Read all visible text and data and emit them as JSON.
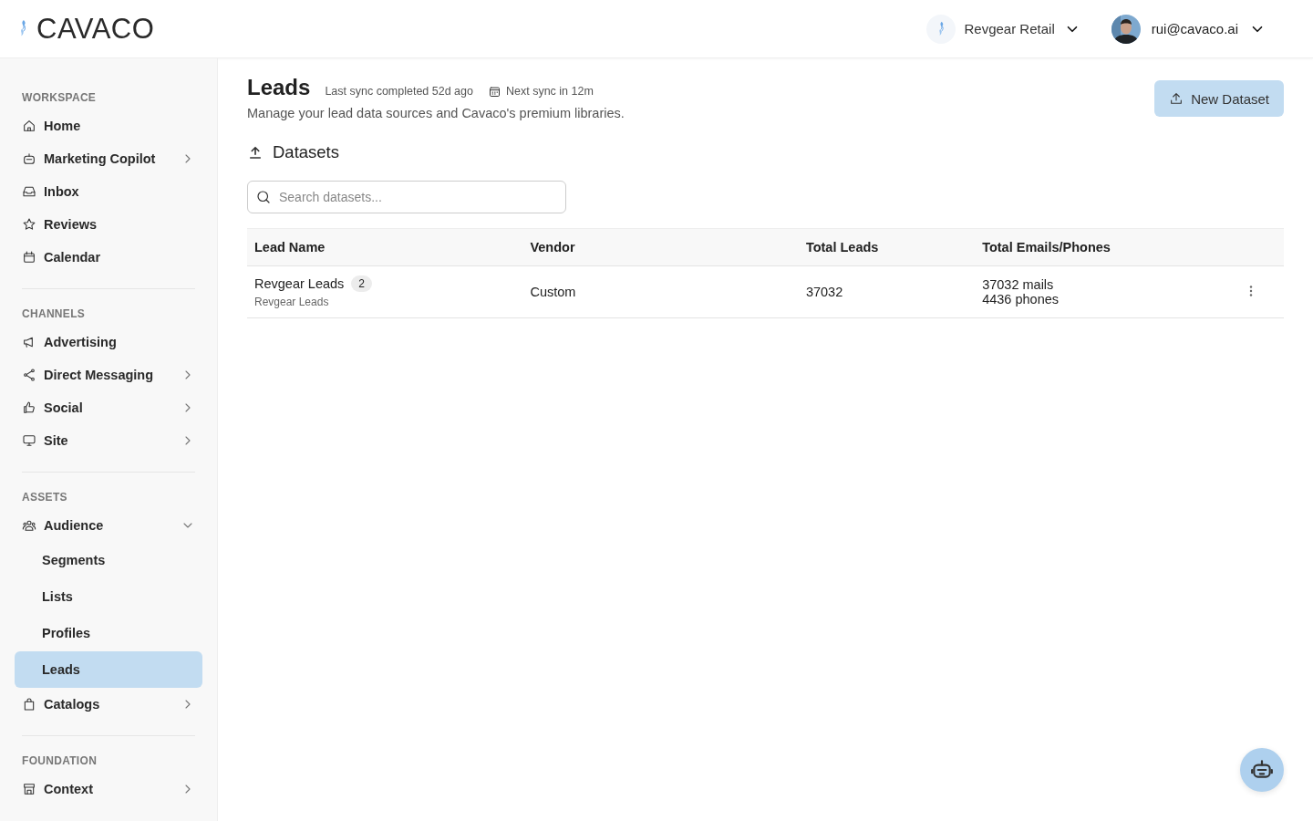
{
  "header": {
    "logo": "CAVACO",
    "workspace": "Revgear Retail",
    "user": "rui@cavaco.ai"
  },
  "sidebar": {
    "sections": [
      {
        "title": "WORKSPACE",
        "items": [
          {
            "label": "Home",
            "kind": "link",
            "selected": false
          },
          {
            "label": "Marketing Copilot",
            "kind": "group",
            "expanded": false,
            "selected": false
          },
          {
            "label": "Inbox",
            "kind": "link",
            "selected": false
          },
          {
            "label": "Reviews",
            "kind": "link",
            "selected": false
          },
          {
            "label": "Calendar",
            "kind": "link",
            "selected": false
          }
        ]
      },
      {
        "title": "CHANNELS",
        "items": [
          {
            "label": "Advertising",
            "kind": "link",
            "selected": false
          },
          {
            "label": "Direct Messaging",
            "kind": "group",
            "expanded": false,
            "selected": false
          },
          {
            "label": "Social",
            "kind": "group",
            "expanded": false,
            "selected": false
          },
          {
            "label": "Site",
            "kind": "group",
            "expanded": false,
            "selected": false
          }
        ]
      },
      {
        "title": "ASSETS",
        "items": [
          {
            "label": "Audience",
            "kind": "group",
            "expanded": true,
            "selected": false,
            "children": [
              {
                "label": "Segments",
                "selected": false
              },
              {
                "label": "Lists",
                "selected": false
              },
              {
                "label": "Profiles",
                "selected": false
              },
              {
                "label": "Leads",
                "selected": true
              }
            ]
          },
          {
            "label": "Catalogs",
            "kind": "group",
            "expanded": false,
            "selected": false
          }
        ]
      },
      {
        "title": "FOUNDATION",
        "items": [
          {
            "label": "Context",
            "kind": "group",
            "expanded": false,
            "selected": false
          }
        ]
      }
    ]
  },
  "page": {
    "title": "Leads",
    "last_sync": "Last sync completed 52d ago",
    "next_sync": "Next sync in 12m",
    "subtitle": "Manage your lead data sources and Cavaco's premium libraries.",
    "new_button": "New Dataset"
  },
  "datasets": {
    "title": "Datasets",
    "search": {
      "placeholder": "Search datasets..."
    },
    "table": {
      "columns": [
        "Lead Name",
        "Vendor",
        "Total Leads",
        "Total Emails/Phones"
      ],
      "rows": [
        {
          "name": "Revgear Leads",
          "count": "2",
          "subname": "Revgear Leads",
          "vendor": "Custom",
          "total": "37032",
          "mails": "37032 mails",
          "phones": "4436 phones"
        }
      ]
    }
  }
}
